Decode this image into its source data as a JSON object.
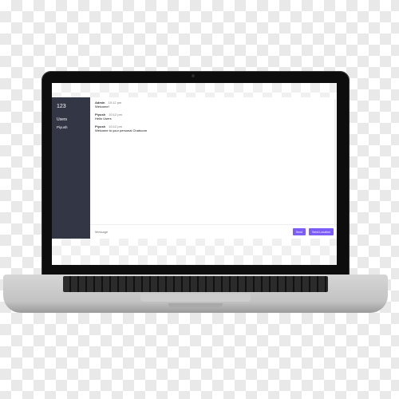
{
  "sidebar": {
    "room": "123",
    "users_heading": "Users",
    "users": [
      "Piyush"
    ]
  },
  "messages": [
    {
      "user": "Admin",
      "time": "10:12 pm",
      "text": "Welcome!"
    },
    {
      "user": "Piyush",
      "time": "10:12 pm",
      "text": "Hello Users"
    },
    {
      "user": "Piyush",
      "time": "10:12 pm",
      "text": "Welcome to your personal Chatroom"
    }
  ],
  "compose": {
    "placeholder": "Message",
    "send_label": "Send",
    "location_label": "Send Location"
  },
  "colors": {
    "sidebar_bg": "#333745",
    "button_bg": "#7c5dfa"
  }
}
